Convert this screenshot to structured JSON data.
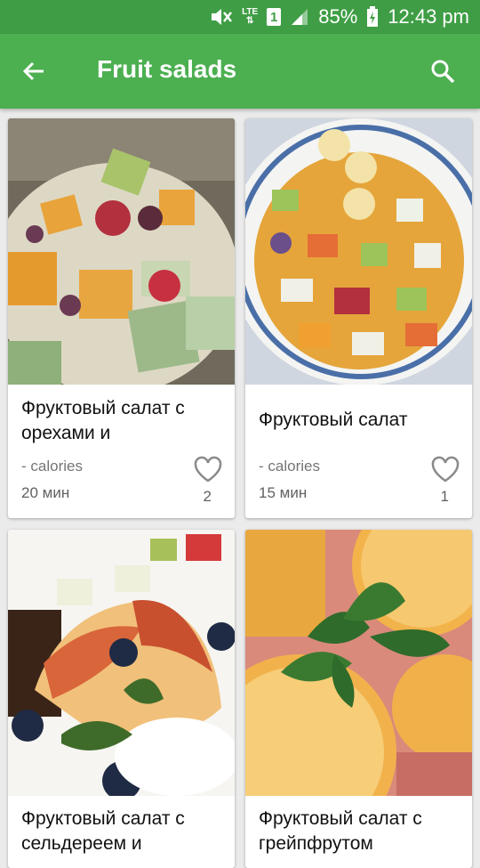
{
  "status_bar": {
    "network": "LTE",
    "sim": "1",
    "battery": "85%",
    "time": "12:43 pm",
    "icons": [
      "mute-icon",
      "lte-icon",
      "sim-icon",
      "signal-icon",
      "battery-charging-icon"
    ]
  },
  "app_bar": {
    "title": "Fruit salads",
    "back_icon": "arrow-back-icon",
    "search_icon": "search-icon",
    "color": "#4caf50"
  },
  "recipes": [
    {
      "title": "Фруктовый салат с орехами и",
      "calories": "- calories",
      "time": "20 мин",
      "likes": "2",
      "image": "fruit-salad-with-nuts"
    },
    {
      "title": "Фруктовый салат",
      "calories": "- calories",
      "time": "15 мин",
      "likes": "1",
      "image": "fruit-salad-bowl"
    },
    {
      "title": "Фруктовый салат с сельдереем и",
      "image": "fruit-salad-with-celery"
    },
    {
      "title": "Фруктовый салат с грейпфрутом",
      "image": "grapefruit-salad-with-mint"
    }
  ]
}
